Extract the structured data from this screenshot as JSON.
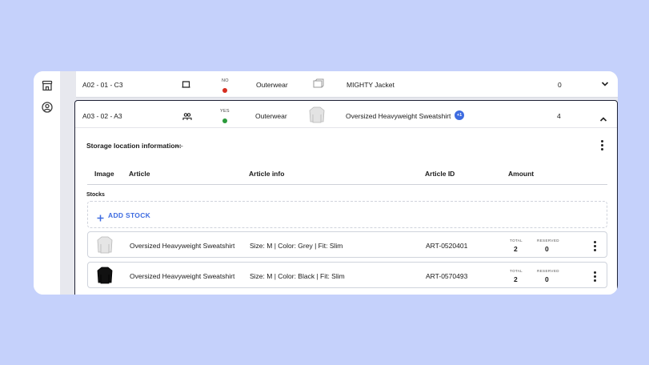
{
  "row1": {
    "location": "A02 - 01 - C3",
    "status_label": "NO",
    "status_color": "#d62d20",
    "category": "Outerwear",
    "article": "MIGHTY Jacket",
    "amount": "0"
  },
  "row2": {
    "location": "A03 - 02 - A3",
    "status_label": "YES",
    "status_color": "#2a9a3b",
    "category": "Outerwear",
    "article": "Oversized Heavyweight Sweatshirt",
    "badge": "+1",
    "amount": "4"
  },
  "panel": {
    "storage_label": "Storage location information:",
    "storage_value": "—",
    "columns": [
      "Image",
      "Article",
      "Article info",
      "Article ID",
      "Amount"
    ],
    "stocks_label": "Stocks",
    "add_stock": "ADD STOCK",
    "total_label": "TOTAL",
    "reserved_label": "RESERVED",
    "stocks": [
      {
        "article": "Oversized Heavyweight Sweatshirt",
        "info": "Size: M | Color: Grey | Fit: Slim",
        "id": "ART-0520401",
        "total": "2",
        "reserved": "0"
      },
      {
        "article": "Oversized Heavyweight Sweatshirt",
        "info": "Size: M | Color: Black | Fit: Slim",
        "id": "ART-0570493",
        "total": "2",
        "reserved": "0"
      }
    ]
  },
  "icons": {
    "sidebar": [
      "store-icon",
      "user-circle-icon"
    ],
    "accent": "#3d6be0"
  }
}
